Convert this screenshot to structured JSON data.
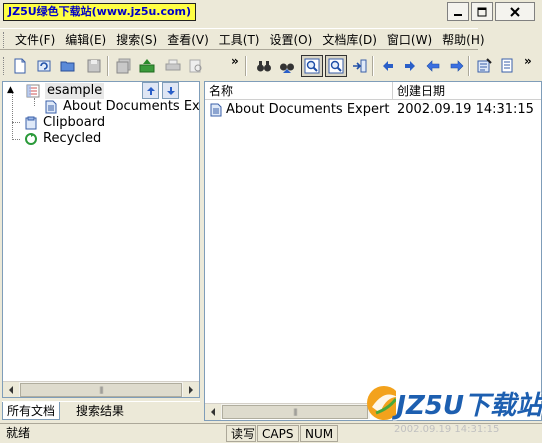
{
  "window": {
    "title": "JZ5U绿色下载站(www.jz5u.com)"
  },
  "menu": [
    "文件(F)",
    "编辑(E)",
    "搜索(S)",
    "查看(V)",
    "工具(T)",
    "设置(O)",
    "文档库(D)",
    "窗口(W)",
    "帮助(H)"
  ],
  "tree": {
    "root": "esample",
    "child": "About Documents Expert",
    "clipboard": "Clipboard",
    "recycled": "Recycled"
  },
  "tabs": [
    "所有文档",
    "搜索结果"
  ],
  "list": {
    "columns": [
      "名称",
      "创建日期"
    ],
    "rows": [
      {
        "name": "About Documents Expert",
        "date": "2002.09.19 14:31:15"
      }
    ]
  },
  "status": {
    "ready": "就绪",
    "ovr": "读写",
    "caps": "CAPS",
    "num": "NUM"
  },
  "watermark": {
    "text": "JZ5U下载站",
    "sub": "2002.09.19 14:31:15"
  },
  "colors": {
    "title_bg": "#ffff44",
    "title_fg": "#0000c8",
    "chrome": "#ece9d8",
    "pane_border": "#7f9db9"
  }
}
